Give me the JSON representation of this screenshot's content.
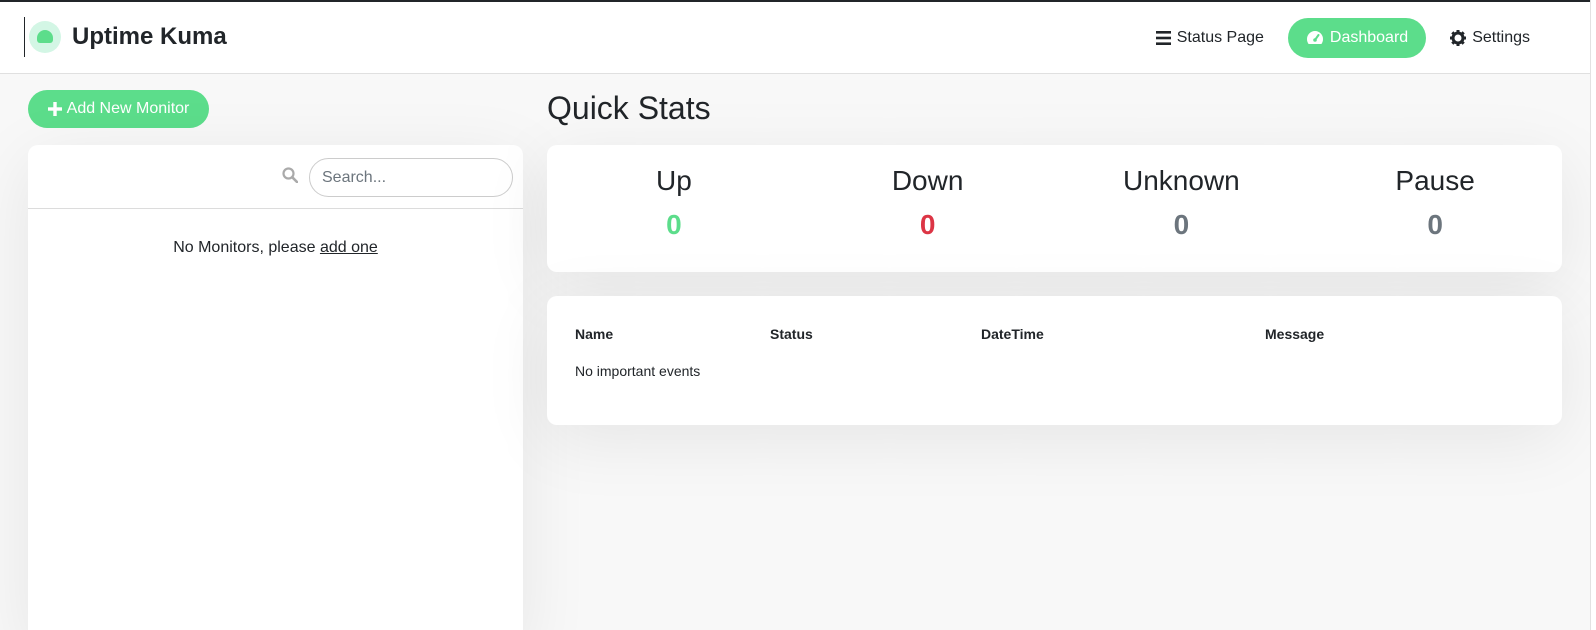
{
  "header": {
    "title": "Uptime Kuma",
    "nav": {
      "status_page": "Status Page",
      "dashboard": "Dashboard",
      "settings": "Settings"
    }
  },
  "sidebar": {
    "add_button": "Add New Monitor",
    "search_placeholder": "Search...",
    "empty_text": "No Monitors, please ",
    "empty_link": "add one"
  },
  "quick_stats": {
    "title": "Quick Stats",
    "stats": [
      {
        "label": "Up",
        "value": "0",
        "color": "#5cdd8b"
      },
      {
        "label": "Down",
        "value": "0",
        "color": "#dc3545"
      },
      {
        "label": "Unknown",
        "value": "0",
        "color": "#6c757d"
      },
      {
        "label": "Pause",
        "value": "0",
        "color": "#6c757d"
      }
    ]
  },
  "events": {
    "columns": [
      "Name",
      "Status",
      "DateTime",
      "Message"
    ],
    "empty_text": "No important events"
  },
  "colors": {
    "accent": "#5cdd8b",
    "danger": "#dc3545",
    "muted": "#6c757d"
  }
}
